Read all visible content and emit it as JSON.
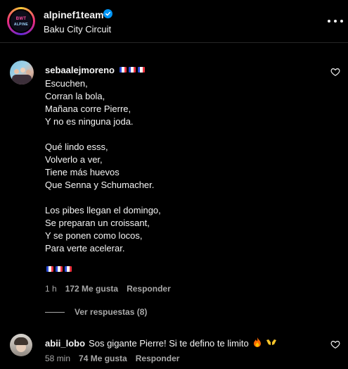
{
  "post": {
    "username": "alpinef1team",
    "location": "Baku City Circuit",
    "avatar_text_top": "BWT",
    "avatar_text_bottom": "ALPINE"
  },
  "comments": [
    {
      "username": "sebaalejmoreno",
      "flags": [
        "fr-flag",
        "fr-flag",
        "fr-flag"
      ],
      "lines": [
        "Escuchen,",
        "Corran la bola,",
        "Mañana corre Pierre,",
        "Y no es ninguna joda.",
        "",
        "Qué lindo esss,",
        "Volverlo a ver,",
        "Tiene más huevos",
        "Que Senna y Schumacher.",
        "",
        "Los pibes llegan el domingo,",
        "Se preparan un croissant,",
        "Y se ponen como locos,",
        "Para verte acelerar."
      ],
      "end_flags": [
        "fr-flag",
        "fr-flag",
        "fr-flag"
      ],
      "time": "1 h",
      "likes": "172 Me gusta",
      "reply": "Responder",
      "view_replies": "Ver respuestas (8)"
    },
    {
      "username": "abii_lobo",
      "text": "Sos gigante Pierre! Si te defino te limito",
      "emojis": [
        "fire-emoji",
        "raising-hands-emoji"
      ],
      "time": "58 min",
      "likes": "74 Me gusta",
      "reply": "Responder"
    }
  ],
  "colors": {
    "background": "#000000",
    "text": "#f5f5f5",
    "secondary_text": "#a8a8a8",
    "verified": "#0095f6"
  }
}
